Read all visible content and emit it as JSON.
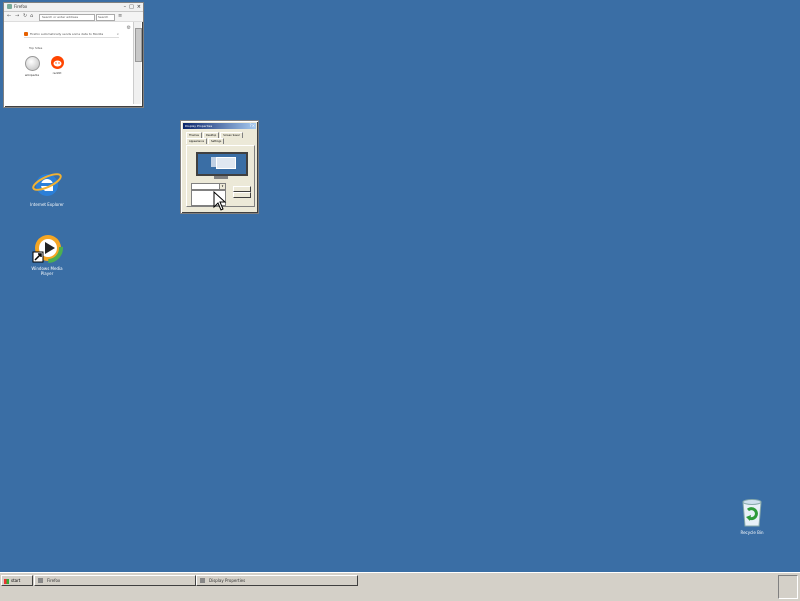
{
  "desktop": {
    "icons": [
      {
        "label": "Internet Explorer",
        "icon": "internet-explorer-icon"
      },
      {
        "label": "Windows Media Player",
        "icon": "windows-media-player-icon"
      },
      {
        "label": "Recycle Bin",
        "icon": "recycle-bin-icon"
      }
    ],
    "background_color": "#3a6ea5"
  },
  "browser": {
    "tab_title": "Firefox",
    "url_text": "Search or enter address",
    "search_placeholder": "Search",
    "notice_text": "Firefox automatically sends some data to Mozilla",
    "top_sites_heading": "Top Sites",
    "sites": [
      {
        "label": "wikipedia",
        "icon": "wikipedia-icon",
        "color": "#ddd"
      },
      {
        "label": "reddit",
        "icon": "reddit-icon",
        "color": "#ff4500"
      }
    ]
  },
  "dialog": {
    "title": "Display Properties",
    "tabs": [
      "Themes",
      "Desktop",
      "Screen Saver",
      "Appearance",
      "Settings"
    ],
    "combo_value": "",
    "buttons": {
      "ok": "",
      "apply": ""
    }
  },
  "taskbar": {
    "start_label": "start",
    "tasks": [
      {
        "label": "Firefox"
      },
      {
        "label": "Display Properties"
      }
    ],
    "clock": ""
  }
}
